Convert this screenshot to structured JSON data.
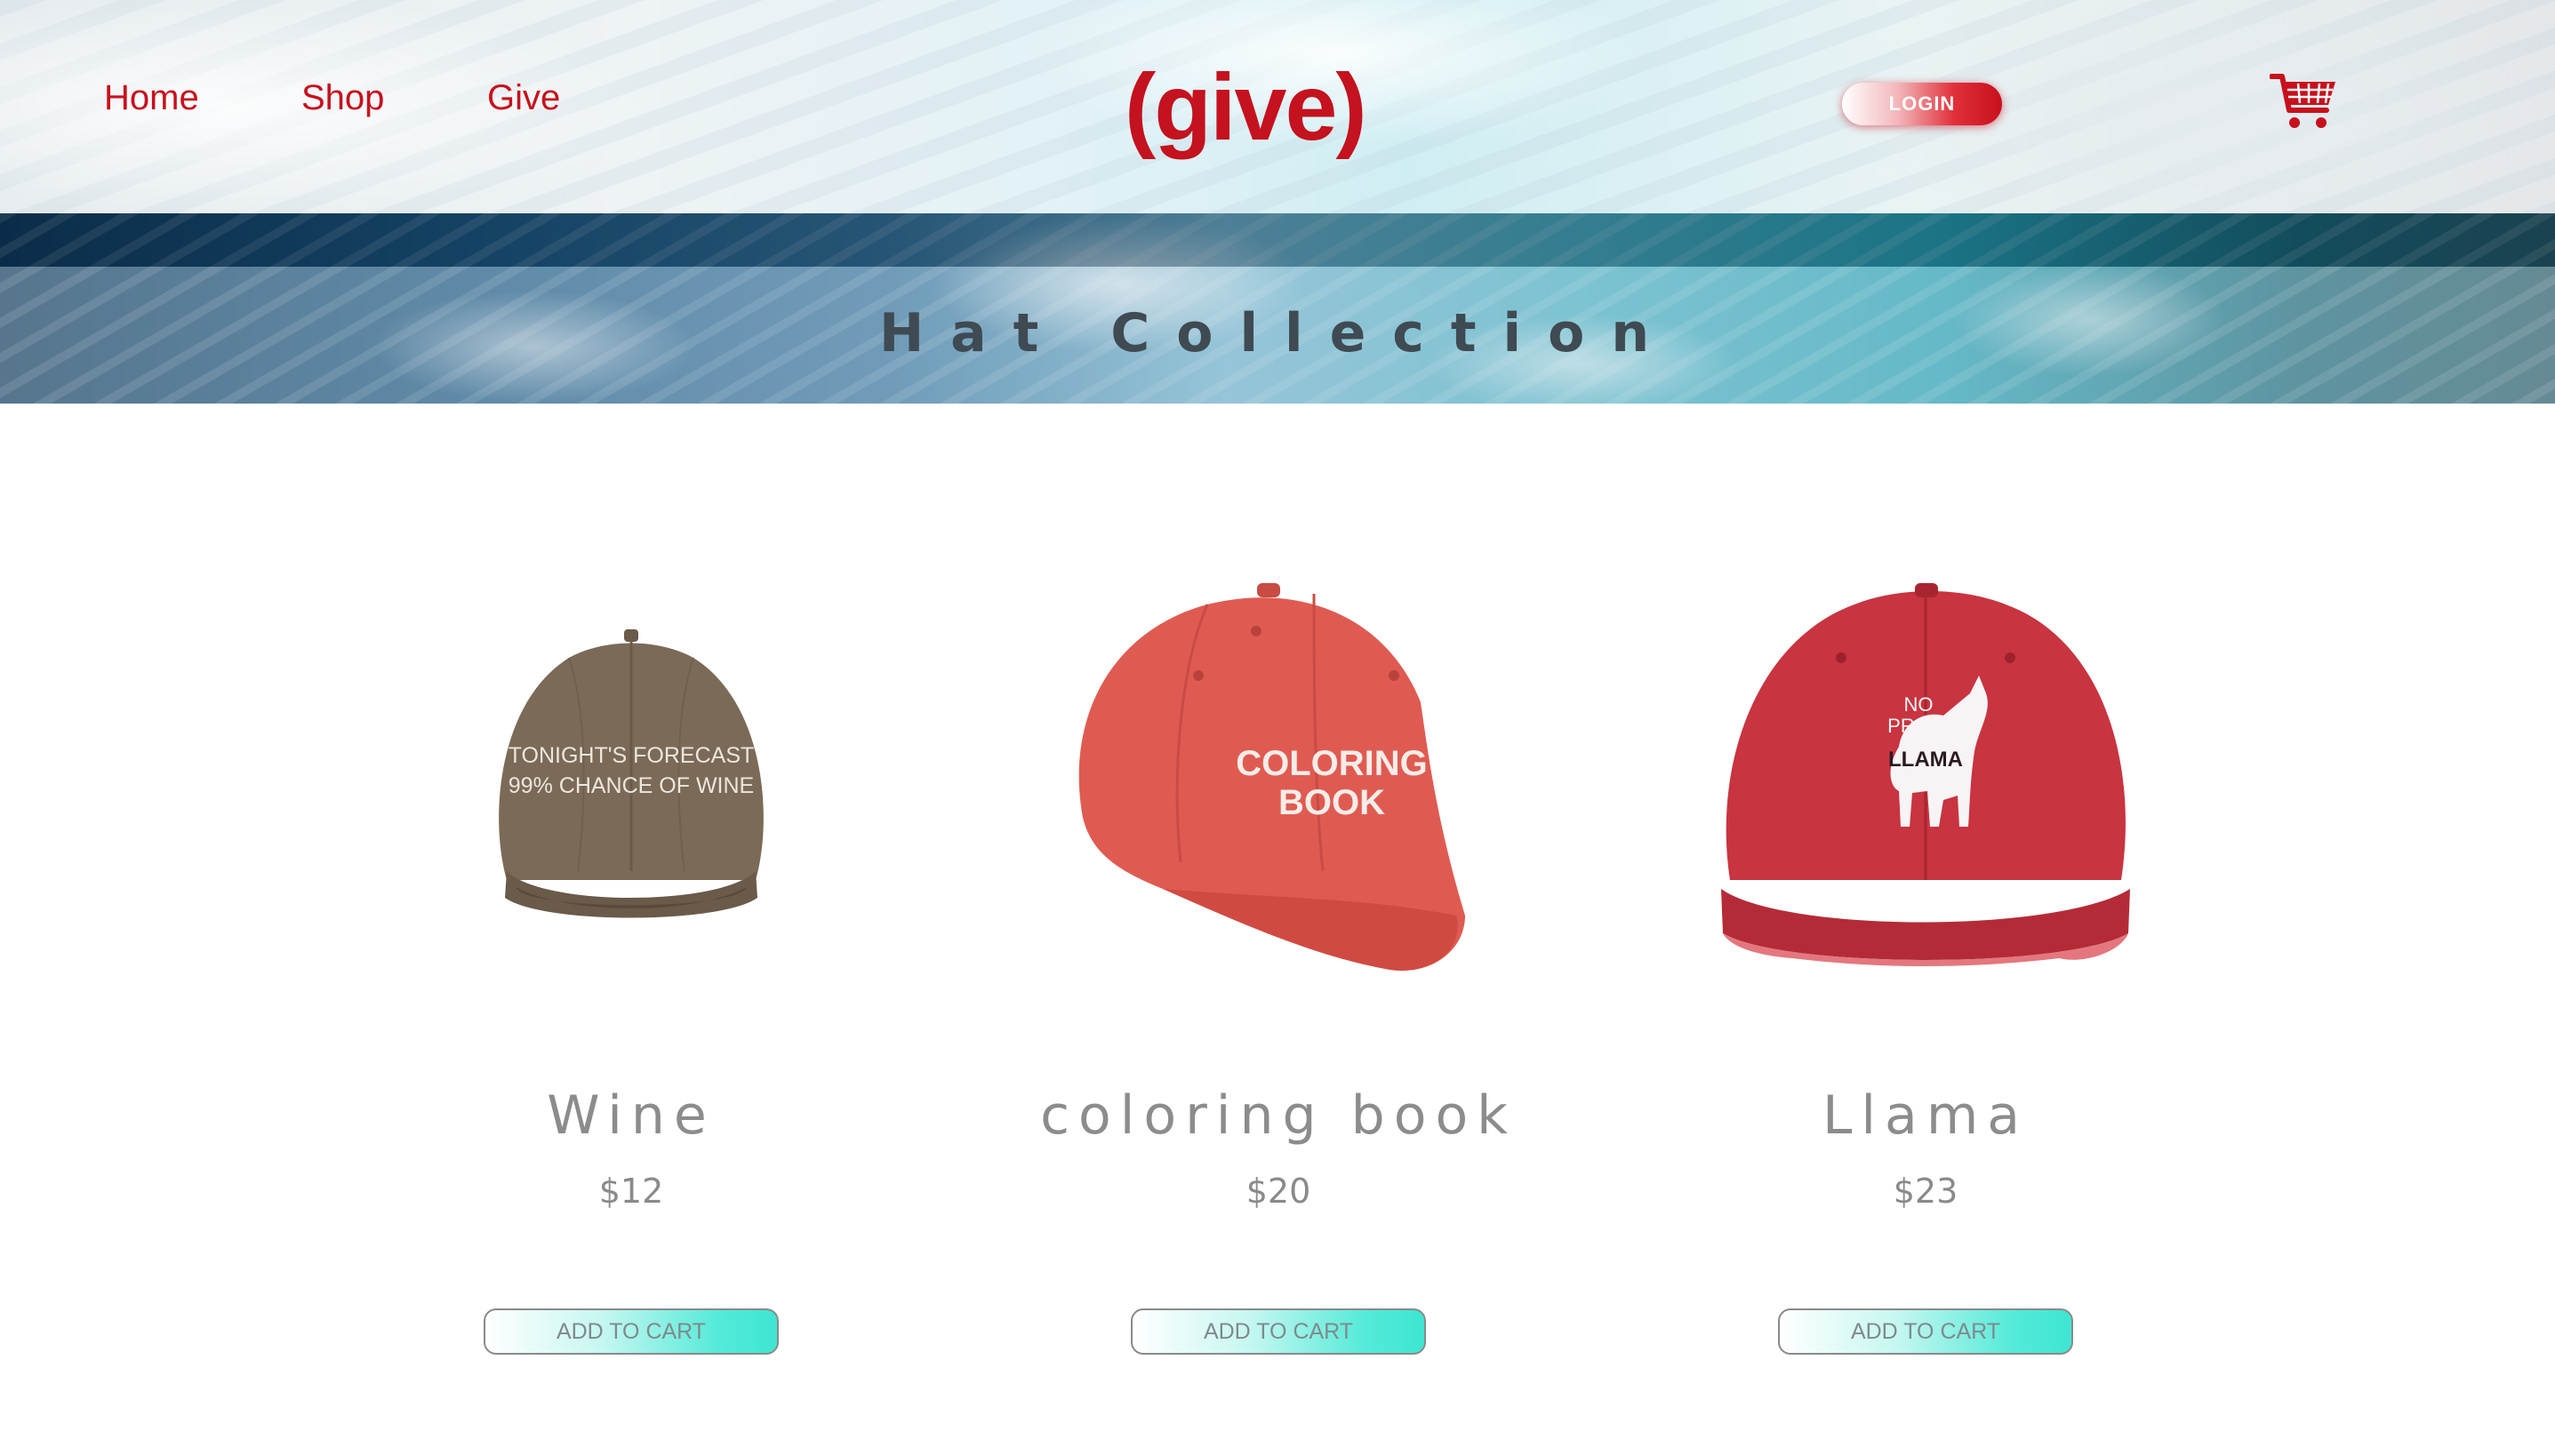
{
  "nav": {
    "home": "Home",
    "shop": "Shop",
    "give": "Give"
  },
  "brand": {
    "logo": "(give)"
  },
  "header": {
    "login_label": "LOGIN",
    "cart_icon": "shopping-cart-icon"
  },
  "banner": {
    "title": "Hat Collection"
  },
  "products": [
    {
      "name": "Wine",
      "price": "$12",
      "button": "ADD TO CART",
      "hat_text": [
        "TONIGHT'S FORECAST",
        "99% CHANCE OF WINE"
      ],
      "hat_color": "#7b6a58"
    },
    {
      "name": "coloring book",
      "price": "$20",
      "button": "ADD TO CART",
      "hat_text": [
        "COLORING",
        "BOOK"
      ],
      "hat_color": "#df5b52"
    },
    {
      "name": "Llama",
      "price": "$23",
      "button": "ADD TO CART",
      "hat_text": [
        "NO",
        "PROB-",
        "LLAMA"
      ],
      "hat_color": "#c83440"
    }
  ],
  "colors": {
    "brand_red": "#c8101d",
    "button_teal": "#3ee6d3",
    "text_gray": "#8c8c8c"
  }
}
